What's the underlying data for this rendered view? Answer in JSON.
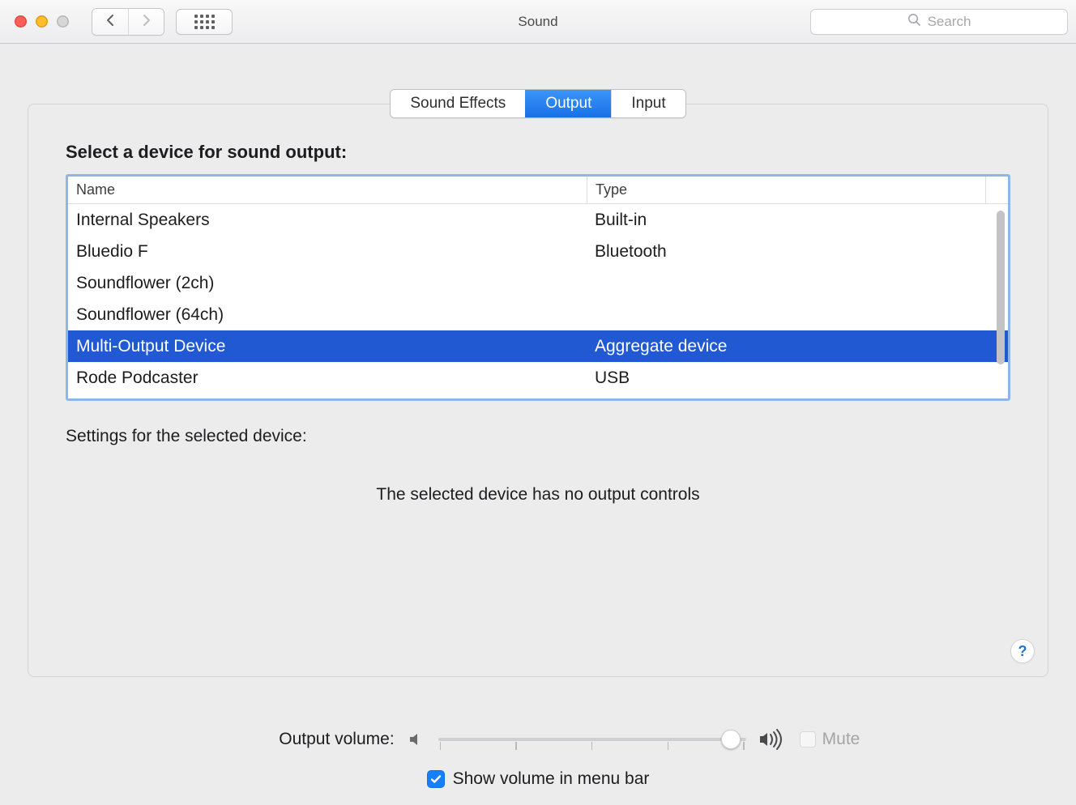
{
  "window": {
    "title": "Sound"
  },
  "search": {
    "placeholder": "Search"
  },
  "tabs": {
    "items": [
      "Sound Effects",
      "Output",
      "Input"
    ],
    "active_index": 1
  },
  "main": {
    "select_label": "Select a device for sound output:",
    "columns": {
      "name": "Name",
      "type": "Type"
    },
    "devices": [
      {
        "name": "Internal Speakers",
        "type": "Built-in",
        "selected": false
      },
      {
        "name": "Bluedio F",
        "type": "Bluetooth",
        "selected": false
      },
      {
        "name": "Soundflower (2ch)",
        "type": "",
        "selected": false
      },
      {
        "name": "Soundflower (64ch)",
        "type": "",
        "selected": false
      },
      {
        "name": "Multi-Output Device",
        "type": "Aggregate device",
        "selected": true
      },
      {
        "name": "Rode Podcaster",
        "type": "USB",
        "selected": false
      }
    ],
    "settings_label": "Settings for the selected device:",
    "no_controls_message": "The selected device has no output controls"
  },
  "footer": {
    "output_volume_label": "Output volume:",
    "volume_percent": 95,
    "mute_label": "Mute",
    "mute_checked": false,
    "show_in_menu_bar_label": "Show volume in menu bar",
    "show_in_menu_bar_checked": true
  }
}
